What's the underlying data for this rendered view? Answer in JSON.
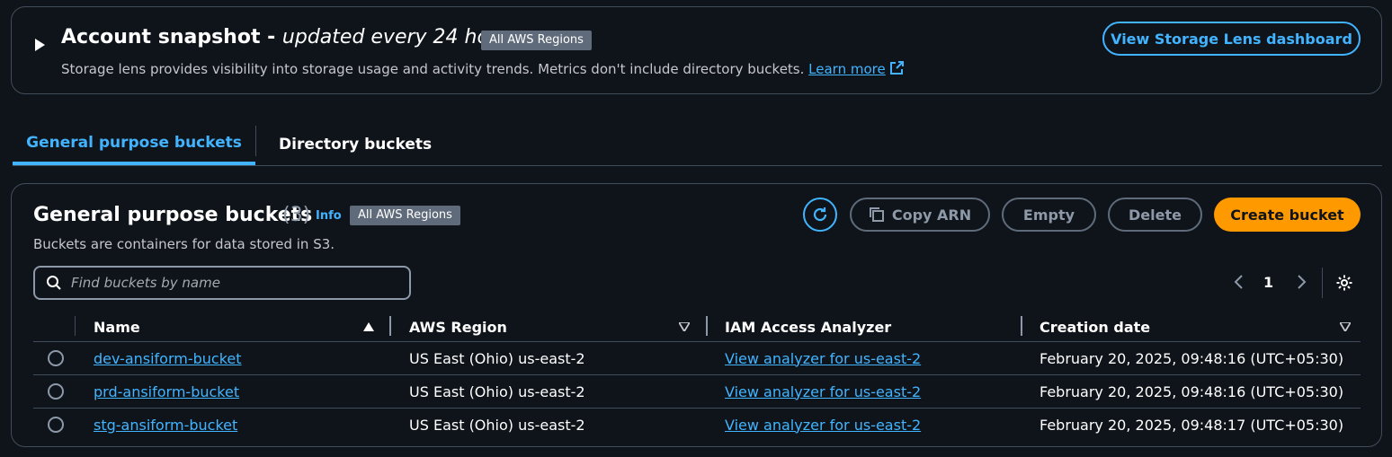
{
  "snapshot": {
    "title_main": "Account snapshot - ",
    "title_italic": "updated every 24 hours",
    "badge": "All AWS Regions",
    "description": "Storage lens provides visibility into storage usage and activity trends. Metrics don't include directory buckets. ",
    "learn_more": "Learn more",
    "dashboard_button": "View Storage Lens dashboard"
  },
  "tabs": [
    {
      "label": "General purpose buckets",
      "active": true
    },
    {
      "label": "Directory buckets",
      "active": false
    }
  ],
  "panel": {
    "title": "General purpose buckets",
    "count": "(3)",
    "info": "Info",
    "badge": "All AWS Regions",
    "description": "Buckets are containers for data stored in S3."
  },
  "toolbar": {
    "copy_arn": "Copy ARN",
    "empty": "Empty",
    "delete": "Delete",
    "create": "Create bucket"
  },
  "search": {
    "placeholder": "Find buckets by name",
    "value": ""
  },
  "pagination": {
    "current_page": "1"
  },
  "table": {
    "columns": [
      "Name",
      "AWS Region",
      "IAM Access Analyzer",
      "Creation date"
    ],
    "rows": [
      {
        "name": "dev-ansiform-bucket",
        "region": "US East (Ohio) us-east-2",
        "analyzer": "View analyzer for us-east-2",
        "created": "February 20, 2025, 09:48:16 (UTC+05:30)"
      },
      {
        "name": "prd-ansiform-bucket",
        "region": "US East (Ohio) us-east-2",
        "analyzer": "View analyzer for us-east-2",
        "created": "February 20, 2025, 09:48:16 (UTC+05:30)"
      },
      {
        "name": "stg-ansiform-bucket",
        "region": "US East (Ohio) us-east-2",
        "analyzer": "View analyzer for us-east-2",
        "created": "February 20, 2025, 09:48:17 (UTC+05:30)"
      }
    ]
  },
  "colors": {
    "background": "#0f141a",
    "accent": "#42b4ff",
    "primary": "#ff9900",
    "border": "#414d5c"
  }
}
